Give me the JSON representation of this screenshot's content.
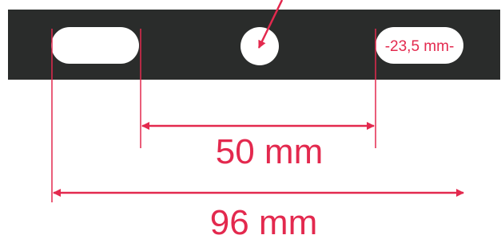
{
  "colors": {
    "bar": "#2a2c2b",
    "slot": "#ffffff",
    "dimension": "#e3294e"
  },
  "annotations": {
    "slot_width": "-23,5 mm-",
    "inner_spacing": "50 mm",
    "outer_spacing": "96 mm"
  }
}
